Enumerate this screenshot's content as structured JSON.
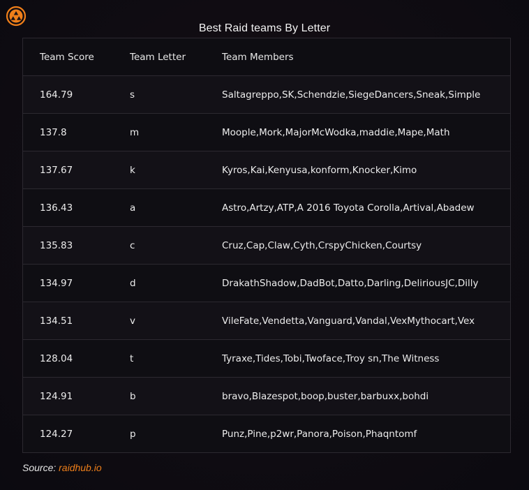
{
  "title": "Best Raid teams By Letter",
  "columns": {
    "score": "Team Score",
    "letter": "Team Letter",
    "members": "Team Members"
  },
  "rows": [
    {
      "score": "164.79",
      "letter": "s",
      "members": "Saltagreppo,SK,Schendzie,SiegeDancers,Sneak,Simple"
    },
    {
      "score": "137.8",
      "letter": "m",
      "members": "Moople,Mork,MajorMcWodka,maddie,Mape,Math"
    },
    {
      "score": "137.67",
      "letter": "k",
      "members": "Kyros,Kai,Kenyusa,konform,Knocker,Kimo"
    },
    {
      "score": "136.43",
      "letter": "a",
      "members": "Astro,Artzy,ATP,A 2016 Toyota Corolla,Artival,Abadew"
    },
    {
      "score": "135.83",
      "letter": "c",
      "members": "Cruz,Cap,Claw,Cyth,CrspyChicken,Courtsy"
    },
    {
      "score": "134.97",
      "letter": "d",
      "members": "DrakathShadow,DadBot,Datto,Darling,DeliriousJC,Dilly"
    },
    {
      "score": "134.51",
      "letter": "v",
      "members": "VileFate,Vendetta,Vanguard,Vandal,VexMythocart,Vex"
    },
    {
      "score": "128.04",
      "letter": "t",
      "members": "Tyraxe,Tides,Tobi,Twoface,Troy sn,The Witness"
    },
    {
      "score": "124.91",
      "letter": "b",
      "members": "bravo,Blazespot,boop,buster,barbuxx,bohdi"
    },
    {
      "score": "124.27",
      "letter": "p",
      "members": "Punz,Pine,p2wr,Panora,Poison,Phaqntomf"
    }
  ],
  "source": {
    "label": "Source:",
    "link": "raidhub.io"
  },
  "logo": {
    "icon": "raidhub-logo-icon",
    "color": "#ef7f1a"
  },
  "colors": {
    "accent": "#ef7f1a",
    "background": "#100c12",
    "text": "#ffffff"
  }
}
